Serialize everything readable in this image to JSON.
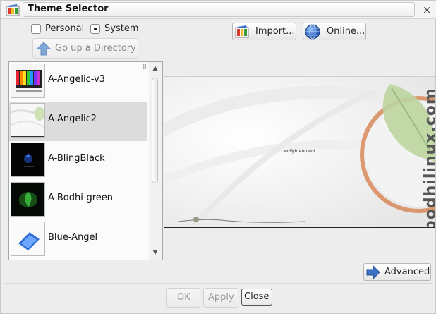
{
  "window": {
    "title": "Theme Selector",
    "close_glyph": "×",
    "app_icon": "theme-icon"
  },
  "source": {
    "personal_label": "Personal",
    "system_label": "System",
    "selected": "System"
  },
  "toolbar": {
    "up_label": "Go up a Directory",
    "import_label": "Import...",
    "online_label": "Online..."
  },
  "themes": {
    "items": [
      {
        "label": "A-Angelic-v3",
        "selected": false
      },
      {
        "label": "A-Angelic2",
        "selected": true
      },
      {
        "label": "A-BlingBlack",
        "selected": false
      },
      {
        "label": "A-Bodhi-green",
        "selected": false
      },
      {
        "label": "Blue-Angel",
        "selected": false
      }
    ]
  },
  "preview": {
    "watermark": "bodhilinux.com",
    "logo_text": "enlightenment"
  },
  "actions": {
    "advanced_label": "Advanced",
    "ok_label": "OK",
    "apply_label": "Apply",
    "close_label": "Close"
  },
  "colors": {
    "accent_blue": "#3a72c8",
    "leaf_green": "#a7c98a",
    "ring_orange": "#d88a5a",
    "selection_gray": "#dcdcdc"
  }
}
